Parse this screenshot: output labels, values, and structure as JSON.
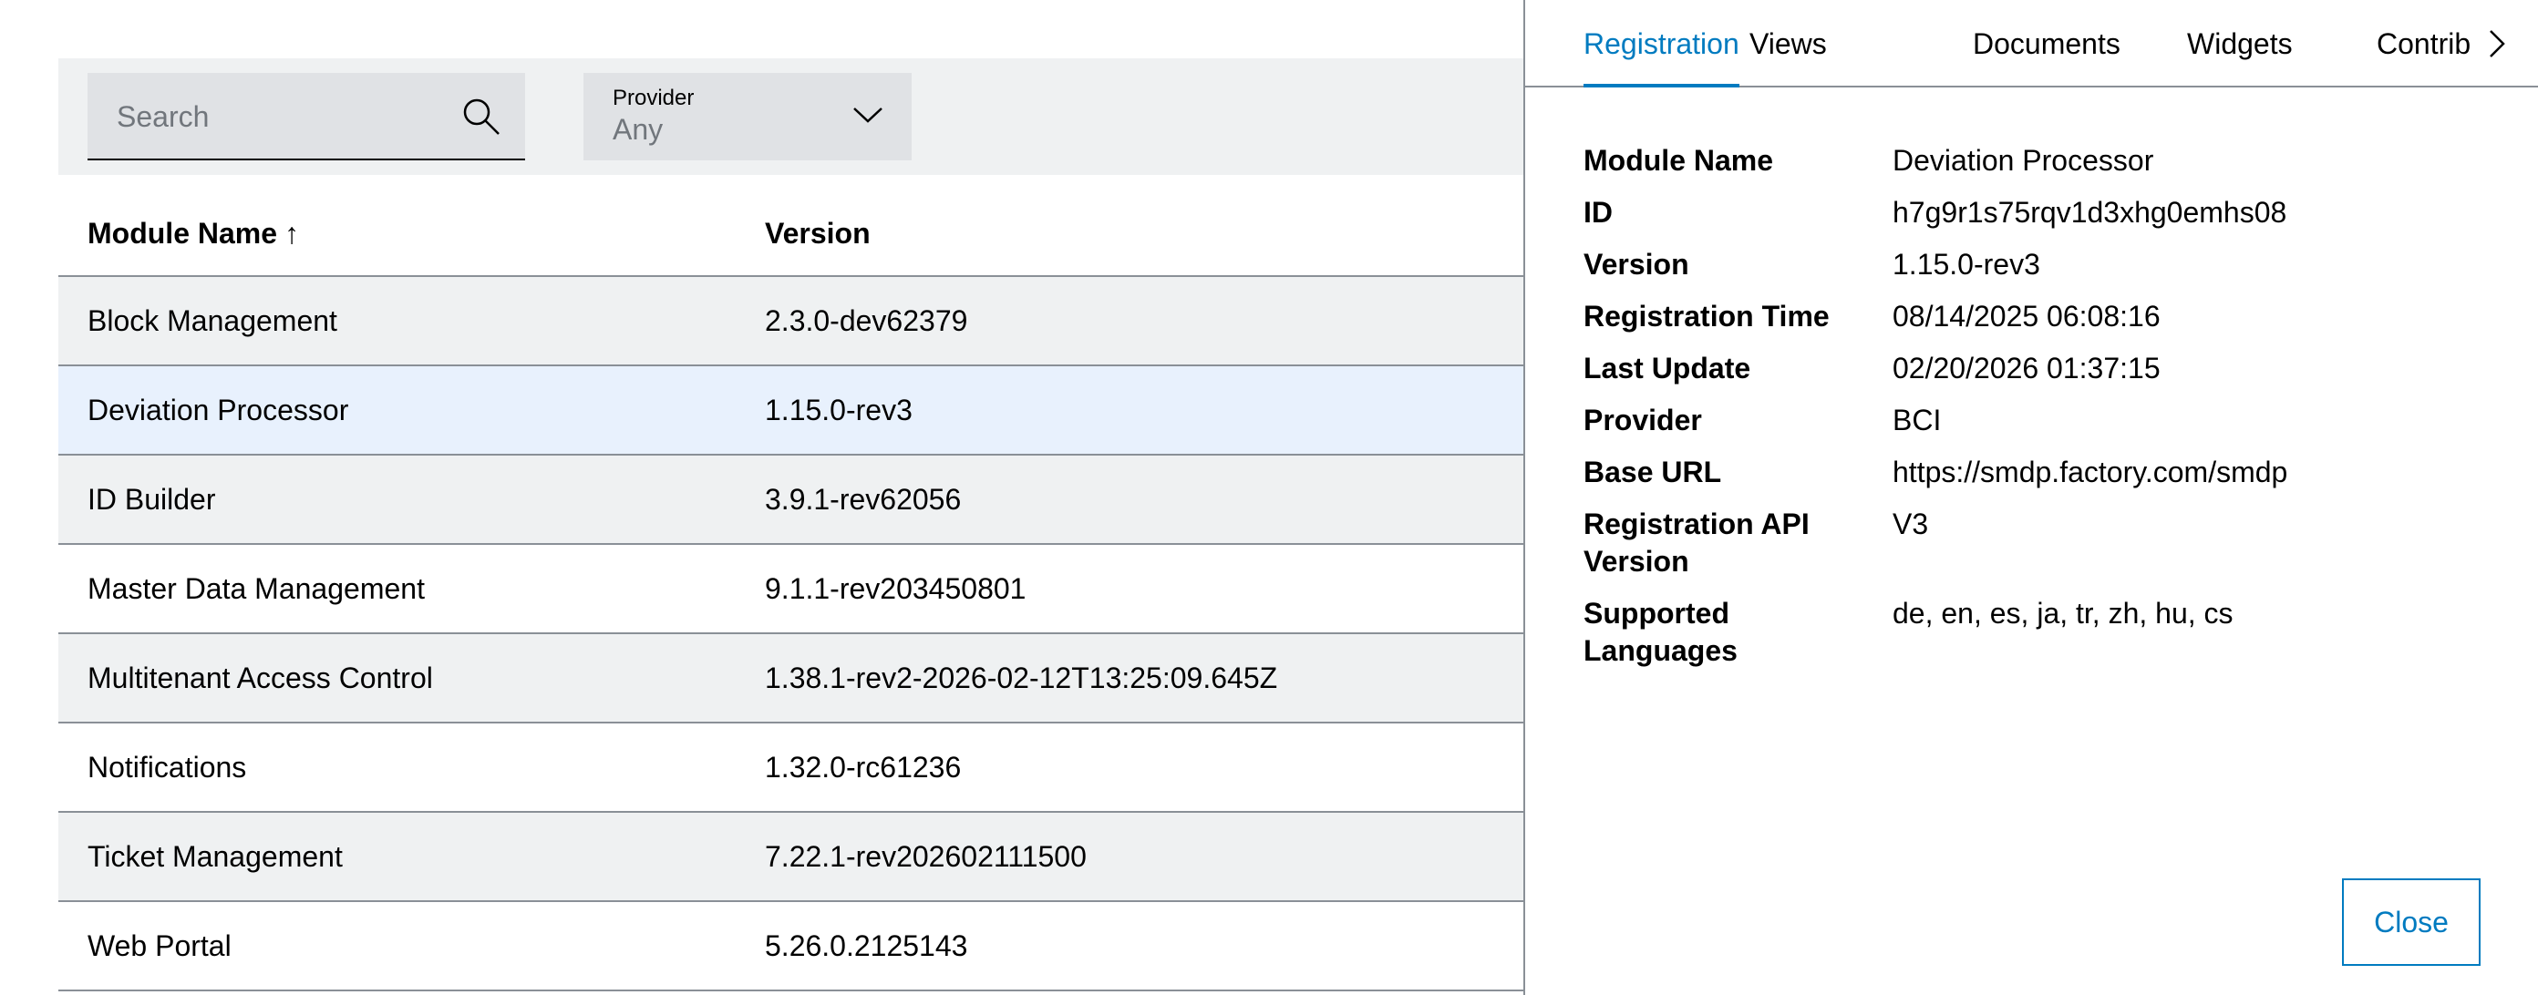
{
  "toolbar": {
    "search_placeholder": "Search",
    "provider_label": "Provider",
    "provider_value": "Any"
  },
  "table": {
    "columns": [
      "Module Name",
      "Version"
    ],
    "sort_indicator": "↑",
    "rows": [
      {
        "name": "Block Management",
        "version": "2.3.0-dev62379"
      },
      {
        "name": "Deviation Processor",
        "version": "1.15.0-rev3"
      },
      {
        "name": "ID Builder",
        "version": "3.9.1-rev62056"
      },
      {
        "name": "Master Data Management",
        "version": "9.1.1-rev203450801"
      },
      {
        "name": "Multitenant Access Control",
        "version": "1.38.1-rev2-2026-02-12T13:25:09.645Z"
      },
      {
        "name": "Notifications",
        "version": "1.32.0-rc61236"
      },
      {
        "name": "Ticket Management",
        "version": "7.22.1-rev202602111500"
      },
      {
        "name": "Web Portal",
        "version": "5.26.0.2125143"
      }
    ],
    "selected_row": "Deviation Processor"
  },
  "panel": {
    "tabs": [
      "Registration",
      "Views",
      "Documents",
      "Widgets",
      "Contrib"
    ],
    "active_tab": "Registration",
    "properties": [
      {
        "key": "Module Name",
        "value": "Deviation Processor"
      },
      {
        "key": "ID",
        "value": "h7g9r1s75rqv1d3xhg0emhs08"
      },
      {
        "key": "Version",
        "value": "1.15.0-rev3"
      },
      {
        "key": "Registration Time",
        "value": "08/14/2025 06:08:16"
      },
      {
        "key": "Last Update",
        "value": "02/20/2026 01:37:15"
      },
      {
        "key": "Provider",
        "value": "BCI"
      },
      {
        "key": "Base URL",
        "value": "https://smdp.factory.com/smdp"
      },
      {
        "key": "Registration API Version",
        "value": "V3"
      },
      {
        "key": "Supported Languages",
        "value": "de, en, es, ja, tr, zh, hu, cs"
      }
    ],
    "close_label": "Close"
  },
  "colors": {
    "accent": "#007bc0",
    "row_alt": "#eff1f2",
    "row_selected": "#e8f1fd",
    "border": "#8a9097"
  },
  "icons": {
    "search": "search-icon",
    "dropdown": "chevron-down-icon",
    "sort": "arrow-up-icon",
    "tabs_next": "chevron-right-icon",
    "resize": "resize-handle-icon"
  }
}
